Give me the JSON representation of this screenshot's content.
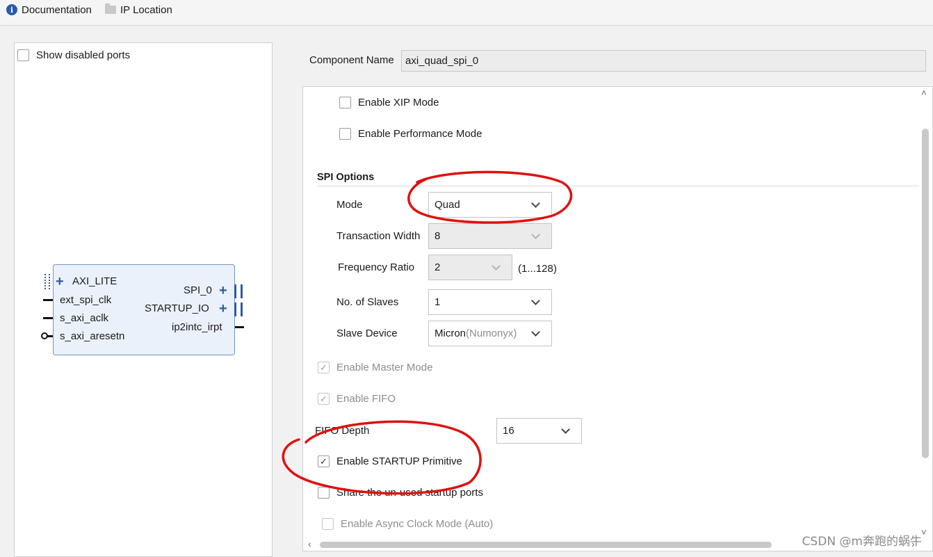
{
  "toolbar": {
    "documentation_label": "Documentation",
    "documentation_icon": "info-icon",
    "ip_location_label": "IP Location",
    "ip_location_icon": "folder-icon"
  },
  "left_panel": {
    "show_disabled_ports_label": "Show disabled ports",
    "show_disabled_ports_checked": false,
    "ip_symbol": {
      "left_ports": [
        "AXI_LITE",
        "ext_spi_clk",
        "s_axi_aclk",
        "s_axi_aresetn"
      ],
      "right_ports": [
        "SPI_0",
        "STARTUP_IO",
        "ip2intc_irpt"
      ]
    }
  },
  "component_name": {
    "label": "Component Name",
    "value": "axi_quad_spi_0"
  },
  "options": {
    "enable_xip_mode": {
      "label": "Enable XIP Mode",
      "checked": false
    },
    "enable_performance_mode": {
      "label": "Enable Performance Mode",
      "checked": false
    },
    "spi_options_title": "SPI Options",
    "mode": {
      "label": "Mode",
      "value": "Quad"
    },
    "transaction_width": {
      "label": "Transaction Width",
      "value": "8"
    },
    "frequency_ratio": {
      "label": "Frequency Ratio",
      "value": "2",
      "range": "(1...128)"
    },
    "no_of_slaves": {
      "label": "No. of Slaves",
      "value": "1"
    },
    "slave_device": {
      "label": "Slave Device",
      "value_main": "Micron",
      "value_sub": "(Numonyx)"
    },
    "enable_master_mode": {
      "label": "Enable Master Mode",
      "checked": true,
      "disabled": true
    },
    "enable_fifo": {
      "label": "Enable FIFO",
      "checked": true,
      "disabled": true
    },
    "fifo_depth": {
      "label": "FIFO Depth",
      "value": "16"
    },
    "enable_startup_primitive": {
      "label": "Enable STARTUP Primitive",
      "checked": true
    },
    "share_unused_startup_ports": {
      "label": "Share the un-used startup ports",
      "checked": false
    },
    "enable_async_clock_mode": {
      "label": "Enable Async Clock Mode (Auto)",
      "checked": false,
      "disabled": true
    }
  },
  "watermark": "CSDN @m奔跑的蜗牛",
  "colors": {
    "annotation_red": "#e01010",
    "ip_block_fill": "#eaf1fb",
    "ip_block_border": "#6f94c8",
    "accent_blue": "#2b5aa8"
  }
}
